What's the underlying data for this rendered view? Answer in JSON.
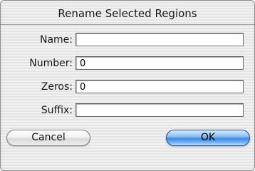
{
  "dialog": {
    "title": "Rename Selected Regions",
    "fields": [
      {
        "label": "Name:",
        "value": ""
      },
      {
        "label": "Number:",
        "value": "0"
      },
      {
        "label": "Zeros:",
        "value": "0"
      },
      {
        "label": "Suffix:",
        "value": ""
      }
    ],
    "buttons": {
      "cancel_label": "Cancel",
      "ok_label": "OK"
    }
  },
  "colors": {
    "default_button_blue": "#3f8ae0",
    "window_background": "#ececec"
  }
}
